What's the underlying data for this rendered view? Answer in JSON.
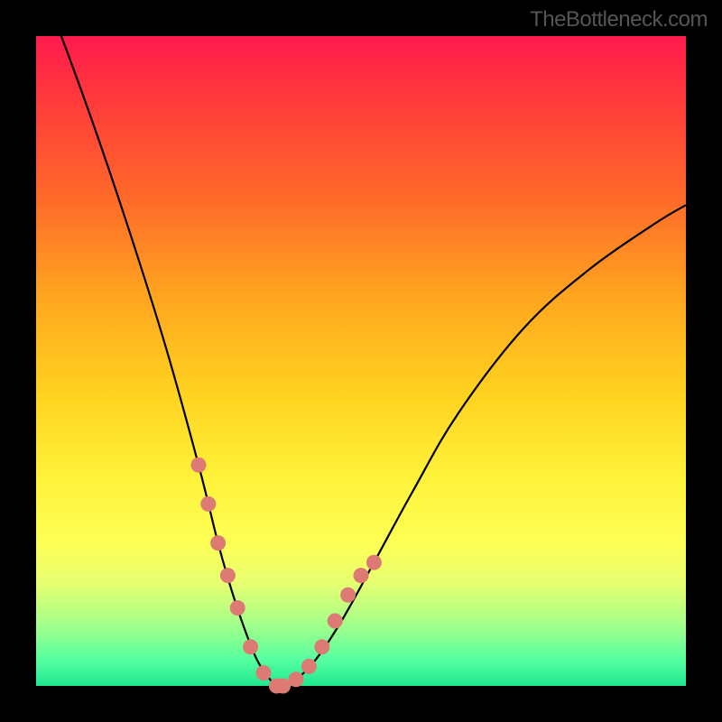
{
  "attribution": "TheBottleneck.com",
  "chart_data": {
    "type": "line",
    "title": "",
    "xlabel": "",
    "ylabel": "",
    "xlim": [
      0,
      100
    ],
    "ylim": [
      0,
      100
    ],
    "series": [
      {
        "name": "bottleneck-curve",
        "x": [
          0,
          5,
          10,
          15,
          20,
          25,
          28,
          30,
          32,
          34,
          36,
          37,
          38,
          40,
          43,
          47,
          52,
          58,
          65,
          75,
          85,
          95,
          100
        ],
        "values": [
          110,
          97,
          83,
          68,
          52,
          34,
          22,
          15,
          9,
          4,
          1,
          0,
          0,
          1,
          4,
          10,
          19,
          30,
          42,
          55,
          64,
          71,
          74
        ]
      }
    ],
    "markers": {
      "name": "highlight-dots",
      "x": [
        25,
        26.5,
        28,
        29.5,
        31,
        33,
        35,
        37,
        38,
        40,
        42,
        44,
        46,
        48,
        50,
        52
      ],
      "y": [
        34,
        28,
        22,
        17,
        12,
        6,
        2,
        0,
        0,
        1,
        3,
        6,
        10,
        14,
        17,
        19
      ]
    },
    "colors": {
      "curve": "#000000",
      "markers": "#dc7a73",
      "gradient_top": "#ff1a4d",
      "gradient_mid": "#ffe040",
      "gradient_bottom": "#20e890"
    }
  }
}
